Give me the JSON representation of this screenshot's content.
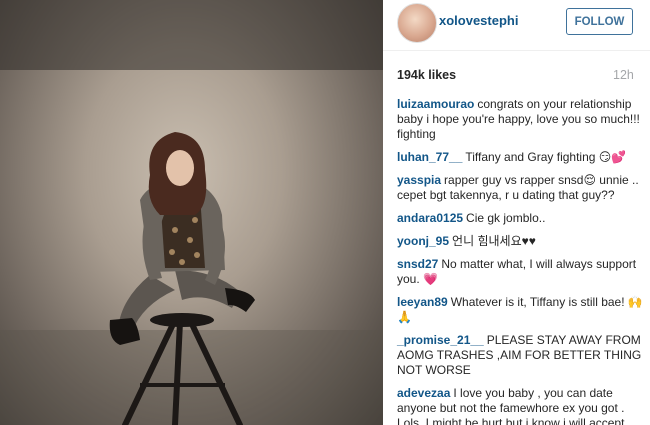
{
  "header": {
    "username": "xolovestephi",
    "follow_label": "FOLLOW"
  },
  "stats": {
    "likes": "194k likes",
    "time": "12h"
  },
  "comments": [
    {
      "user": "luizaamourao",
      "text": "congrats on your relationship baby i hope you're happy, love you so much!!! fighting"
    },
    {
      "user": "luhan_77__",
      "text": "Tiffany and Gray fighting 😏💕"
    },
    {
      "user": "yasspia",
      "text": "rapper guy vs rapper snsd😌 unnie .. cepet bgt takennya, r u dating that guy??"
    },
    {
      "user": "andara0125",
      "text": "Cie gk jomblo.."
    },
    {
      "user": "yoonj_95",
      "text": "언니 힘내세요♥♥"
    },
    {
      "user": "snsd27",
      "text": "No matter what, I will always support you. 💗"
    },
    {
      "user": "leeyan89",
      "text": "Whatever is it, Tiffany is still bae! 🙌 🙏"
    },
    {
      "user": "_promise_21__",
      "text": "PLEASE STAY AWAY FROM AOMG TRASHES ,AIM FOR BETTER THING NOT WORSE"
    },
    {
      "user": "adevezaa",
      "text": "I love you baby , you can date anyone but not the famewhore ex you got . Lols. I might be hurt but i know i will accept"
    }
  ]
}
